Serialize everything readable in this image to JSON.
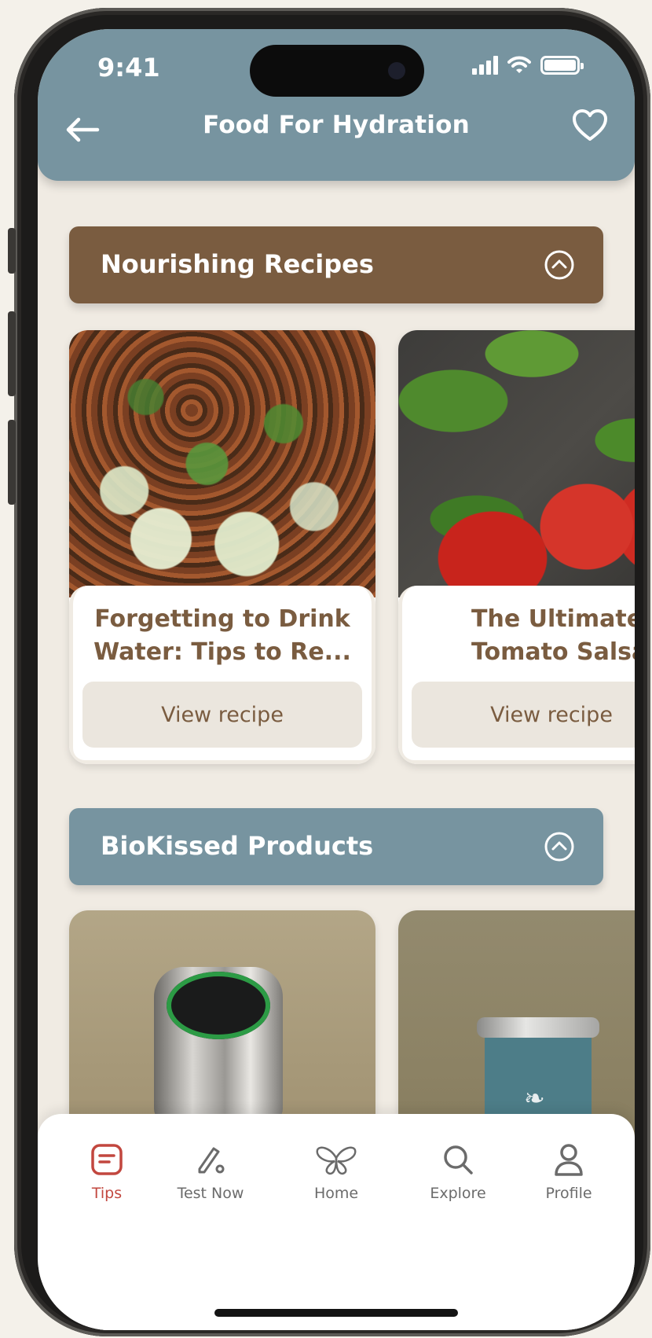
{
  "status_bar": {
    "time": "9:41"
  },
  "header": {
    "title": "Food For Hydration",
    "back_icon": "arrow-left-icon",
    "favorite_icon": "heart-icon"
  },
  "sections": {
    "recipes": {
      "title": "Nourishing Recipes",
      "toggle_icon": "chevron-up-circle-icon",
      "color": "#7a5c40",
      "cards": [
        {
          "title_line1": "Forgetting to Drink",
          "title_line2": "Water: Tips to Re...",
          "button": "View recipe"
        },
        {
          "title_line1": "The Ultimate",
          "title_line2": "Tomato Salsa",
          "button": "View recipe"
        }
      ]
    },
    "products": {
      "title": "BioKissed Products",
      "toggle_icon": "chevron-up-circle-icon",
      "color": "#7794a0"
    }
  },
  "tabbar": {
    "items": [
      {
        "label": "Tips",
        "icon": "tips-icon",
        "active": true
      },
      {
        "label": "Test Now",
        "icon": "pen-icon",
        "active": false
      },
      {
        "label": "Home",
        "icon": "butterfly-icon",
        "active": false
      },
      {
        "label": "Explore",
        "icon": "search-icon",
        "active": false
      },
      {
        "label": "Profile",
        "icon": "user-icon",
        "active": false
      }
    ],
    "active_color": "#c2473f"
  }
}
